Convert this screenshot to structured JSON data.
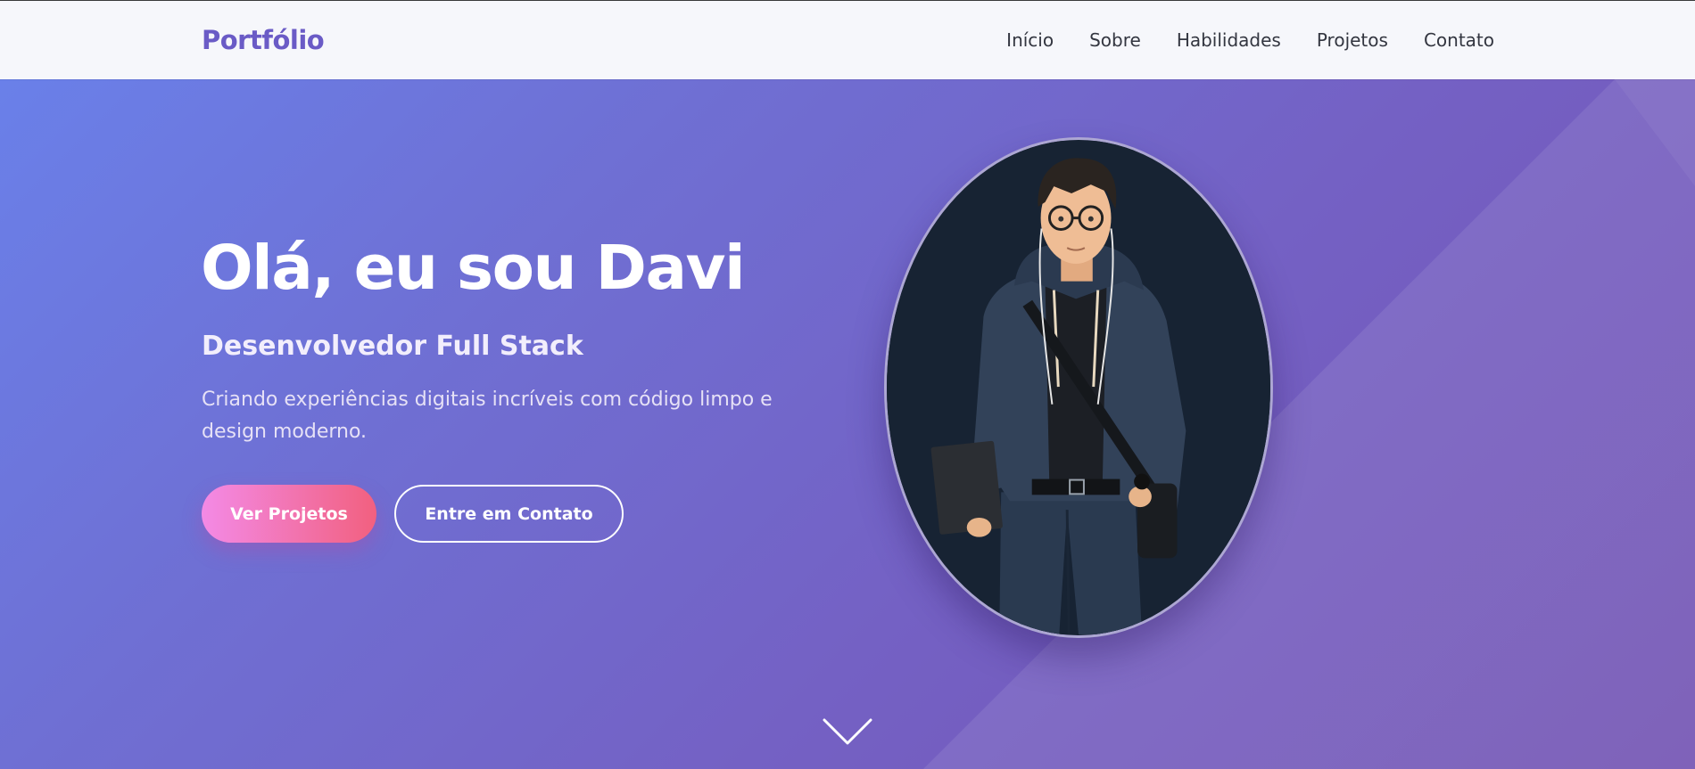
{
  "navbar": {
    "logo": "Portfólio",
    "links": [
      "Início",
      "Sobre",
      "Habilidades",
      "Projetos",
      "Contato"
    ]
  },
  "hero": {
    "title": "Olá, eu sou Davi",
    "subtitle": "Desenvolvedor Full Stack",
    "description": "Criando experiências digitais incríveis com código limpo e design moderno.",
    "primary_button": "Ver Projetos",
    "secondary_button": "Entre em Contato",
    "avatar": "avatar-illustration",
    "scroll_icon": "chevron-down-icon"
  },
  "colors": {
    "brand": "#6a5bc6",
    "hero_gradient_start": "#6a80e9",
    "hero_gradient_end": "#7353b3",
    "button_gradient_start": "#f38ae6",
    "button_gradient_end": "#f2607f",
    "nav_bg": "#f6f7fb"
  }
}
